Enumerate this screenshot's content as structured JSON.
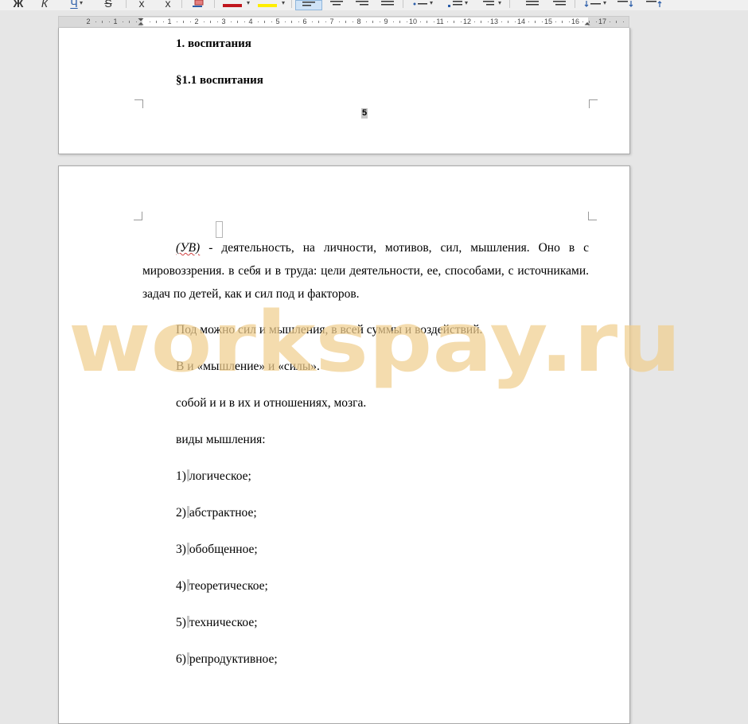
{
  "toolbar": {
    "bold": "Ж",
    "italic": "К",
    "underline": "Ч",
    "strike": "S",
    "superscript": "x",
    "subscript": "x",
    "font_color": "#c0161d",
    "highlight_color": "#ffee00",
    "active_tool": "align-left"
  },
  "ruler": {
    "left_numbers": [
      "2",
      "1"
    ],
    "right_numbers": [
      "1",
      "2",
      "3",
      "4",
      "5",
      "6",
      "7",
      "8",
      "9",
      "10",
      "11",
      "12",
      "13",
      "14",
      "15",
      "16",
      "17"
    ]
  },
  "page1": {
    "heading1": "1. воспитания",
    "heading2": "§1.1  воспитания",
    "page_number": "5"
  },
  "page2": {
    "para1_abbr": "(УВ)",
    "para1_rest": " -   деятельность, на личности, мотивов, сил, мышления. Оно в с мировоззрения. в себя и в труда: цели деятельности, ее, способами, с источниками. задач по детей, как и сил под и факторов.",
    "para2": "Под можно сил и мышления, в всей суммы и воздействий.",
    "para3": "В и «мышление» и «силы».",
    "para4": "собой и и в их и отношениях, мозга.",
    "para5": "виды мышления:",
    "list": [
      {
        "num": "1)",
        "text": "логическое;"
      },
      {
        "num": "2)",
        "text": "абстрактное;"
      },
      {
        "num": "3)",
        "text": "обобщенное;"
      },
      {
        "num": "4)",
        "text": "теоретическое;"
      },
      {
        "num": "5)",
        "text": "техническое;"
      },
      {
        "num": "6)",
        "text": "репродуктивное;"
      }
    ]
  },
  "watermark": {
    "text": "workspay.ru",
    "color": "#f1cf8f"
  }
}
